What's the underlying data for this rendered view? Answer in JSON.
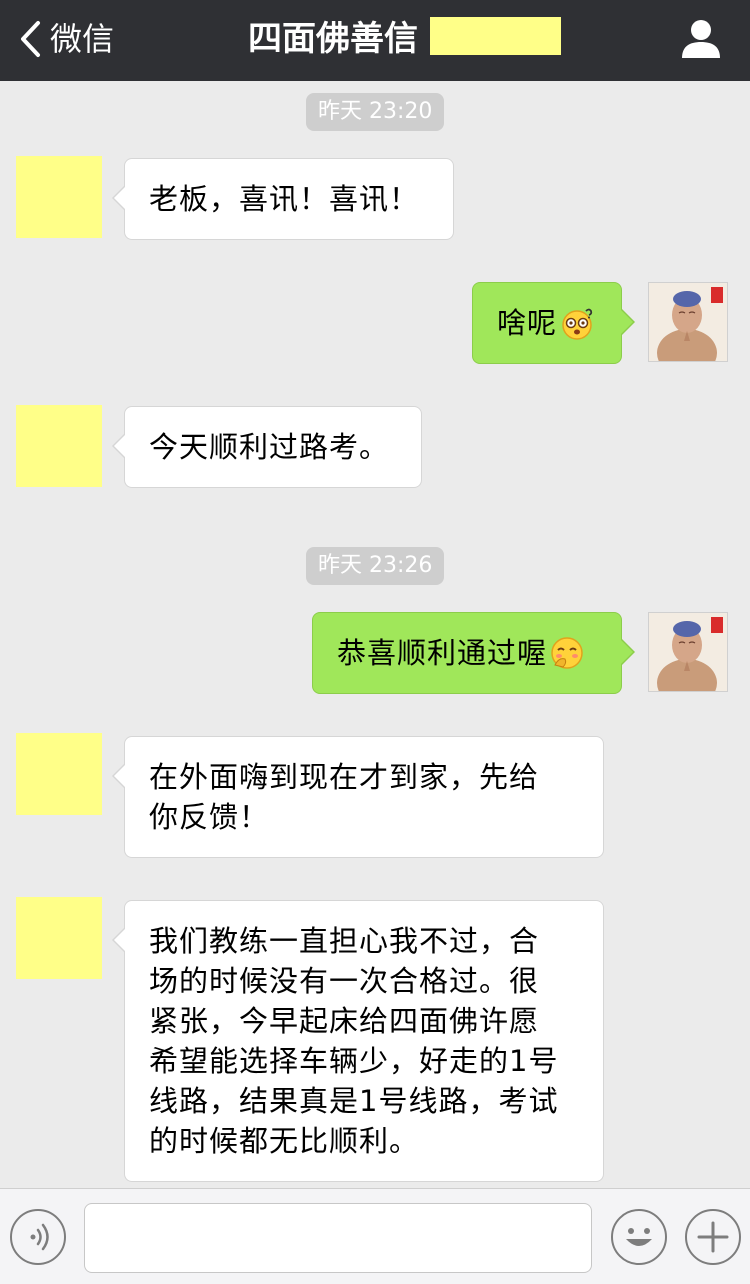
{
  "nav": {
    "back_label": "微信",
    "title": "四面佛善信",
    "back_icon": "chevron-left-icon",
    "profile_icon": "person-icon"
  },
  "timestamps": [
    "昨天 23:20",
    "昨天 23:26"
  ],
  "messages": [
    {
      "side": "left",
      "text": "老板，喜讯！喜讯！"
    },
    {
      "side": "right",
      "text": "啥呢",
      "emoji": "dizzy-face-emoji"
    },
    {
      "side": "left",
      "text": "今天顺利过路考。"
    },
    {
      "side": "right",
      "text": "恭喜顺利通过喔",
      "emoji": "giggle-face-emoji"
    },
    {
      "side": "left",
      "lines": [
        "在外面嗨到现在才到家，先给",
        "你反馈！"
      ]
    },
    {
      "side": "left",
      "lines": [
        "我们教练一直担心我不过，合",
        "场的时候没有一次合格过。很",
        "紧张，今早起床给四面佛许愿",
        "希望能选择车辆少，好走的1号",
        "线路，结果真是1号线路，考试",
        "的时候都无比顺利。"
      ]
    }
  ],
  "input_bar": {
    "voice_icon": "voice-icon",
    "emoji_icon": "smiley-icon",
    "plus_icon": "plus-icon",
    "input_value": ""
  },
  "colors": {
    "nav_bg": "#2f3034",
    "chat_bg": "#ebebeb",
    "self_bubble": "#a0e75a",
    "other_bubble": "#ffffff",
    "redaction": "#ffff88"
  }
}
